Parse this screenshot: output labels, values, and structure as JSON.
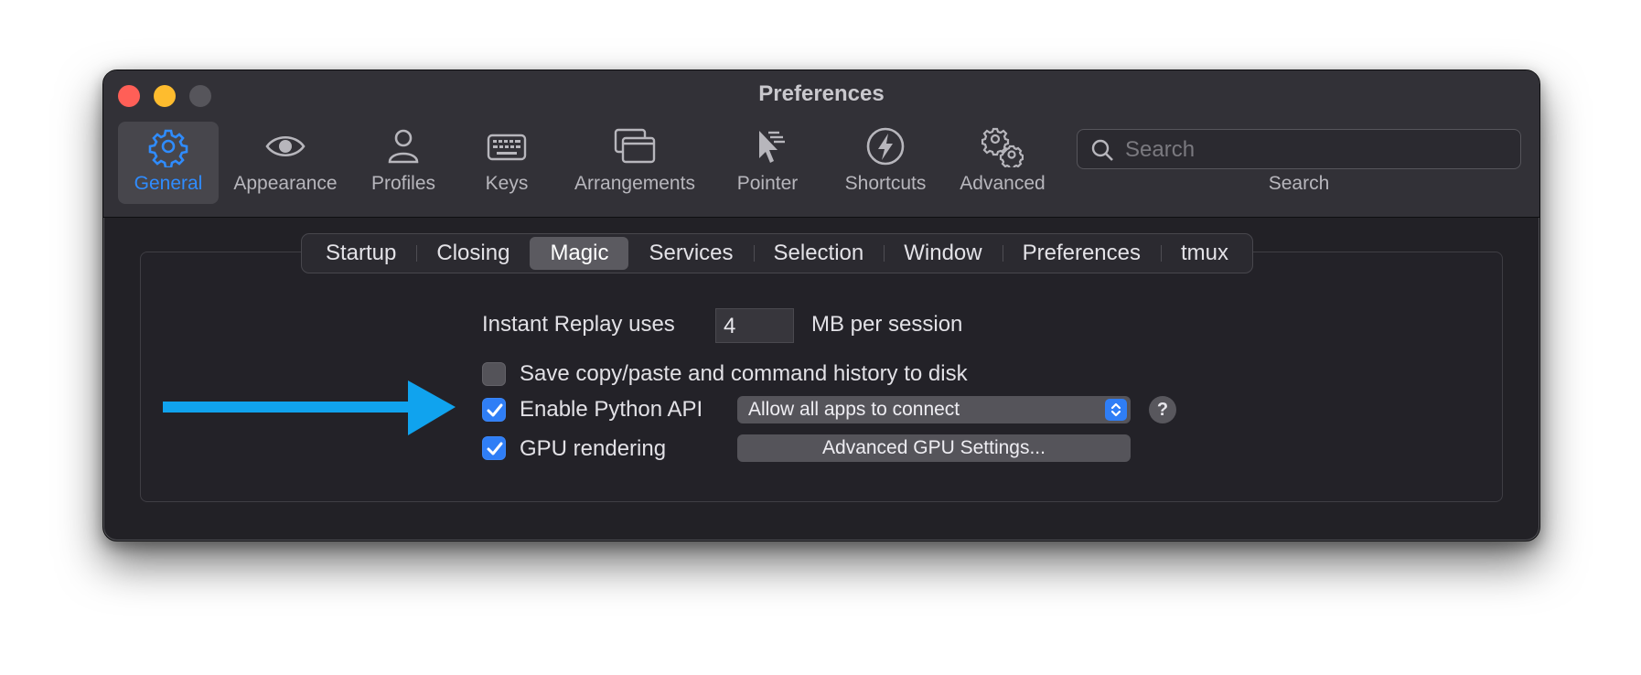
{
  "window": {
    "title": "Preferences"
  },
  "toolbar": {
    "items": [
      {
        "label": "General",
        "icon": "gear-icon",
        "selected": true
      },
      {
        "label": "Appearance",
        "icon": "eye-icon"
      },
      {
        "label": "Profiles",
        "icon": "person-icon"
      },
      {
        "label": "Keys",
        "icon": "keyboard-icon"
      },
      {
        "label": "Arrangements",
        "icon": "windows-icon"
      },
      {
        "label": "Pointer",
        "icon": "pointer-icon"
      },
      {
        "label": "Shortcuts",
        "icon": "lightning-icon"
      },
      {
        "label": "Advanced",
        "icon": "gears-icon"
      }
    ],
    "search_placeholder": "Search",
    "search_label": "Search"
  },
  "tabs": [
    "Startup",
    "Closing",
    "Magic",
    "Services",
    "Selection",
    "Window",
    "Preferences",
    "tmux"
  ],
  "active_tab": "Magic",
  "magic": {
    "replay_label": "Instant Replay uses",
    "replay_value": "4",
    "replay_unit": "MB per session",
    "save_history_label": "Save copy/paste and command history to disk",
    "save_history_checked": false,
    "python_api_label": "Enable Python API",
    "python_api_checked": true,
    "python_api_option": "Allow all apps to connect",
    "help_label": "?",
    "gpu_label": "GPU rendering",
    "gpu_checked": true,
    "gpu_button": "Advanced GPU Settings..."
  },
  "colors": {
    "accent": "#2f7ef6",
    "annotation_arrow": "#10a3ee",
    "close": "#ff5f57",
    "minimize": "#febc2e",
    "zoom_inactive": "#56555b"
  }
}
